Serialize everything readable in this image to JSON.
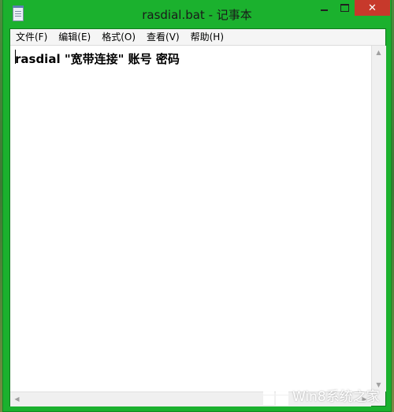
{
  "window": {
    "title": "rasdial.bat - 记事本",
    "close_glyph": "✕"
  },
  "menu": {
    "items": [
      {
        "label": "文件(F)"
      },
      {
        "label": "编辑(E)"
      },
      {
        "label": "格式(O)"
      },
      {
        "label": "查看(V)"
      },
      {
        "label": "帮助(H)"
      }
    ]
  },
  "editor": {
    "content": "rasdial \"宽带连接\" 账号 密码"
  },
  "watermark": {
    "text": "Win8系统之家"
  },
  "icons": {
    "app": "notepad-icon",
    "minimize": "minimize-icon",
    "maximize": "maximize-icon",
    "close": "close-icon",
    "watermark_logo": "windows-logo-icon"
  },
  "colors": {
    "window_frame": "#1bb12e",
    "close_button": "#c7392b",
    "editor_background": "#ffffff"
  }
}
